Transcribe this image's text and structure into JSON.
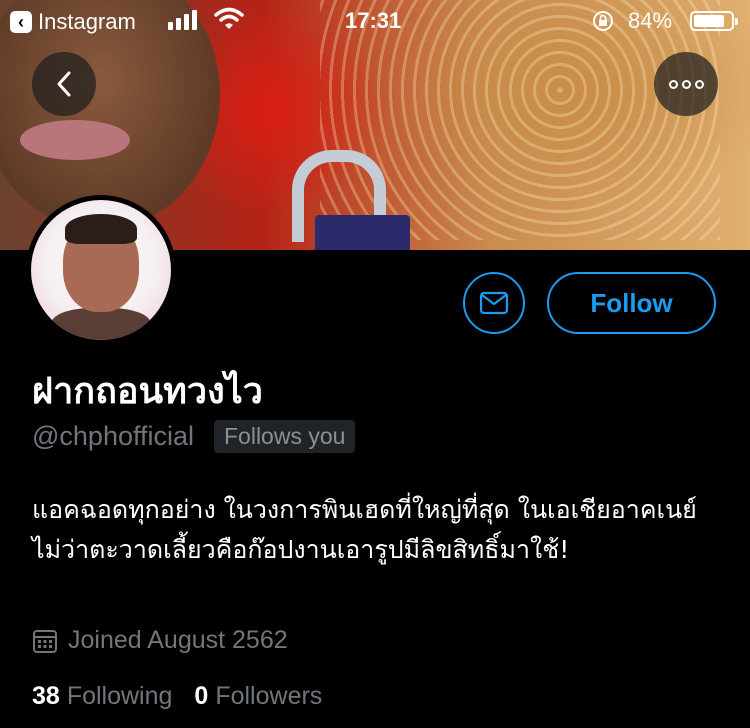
{
  "status_bar": {
    "back_app": "Instagram",
    "time": "17:31",
    "battery_percent": "84%",
    "battery_level": 0.84,
    "signal_bars": 4
  },
  "profile": {
    "display_name": "ฝากถอนทวงไว",
    "handle": "@chphofficial",
    "follows_you": "Follows you",
    "bio": "แอคฉอดทุกอย่าง ในวงการพินเฮดที่ใหญ่ที่สุด ในเอเชียอาคเนย์ ไม่ว่าตะวาดเลี้ยวคือก๊อปงานเอารูปมีลิขสิทธิ์มาใช้!",
    "joined": "Joined August 2562",
    "following_count": "38",
    "following_label": "Following",
    "followers_count": "0",
    "followers_label": "Followers"
  },
  "actions": {
    "follow_label": "Follow"
  },
  "icons": {
    "back": "chevron-left-icon",
    "more": "more-horizontal-icon",
    "mail": "mail-icon",
    "calendar": "calendar-icon"
  },
  "colors": {
    "accent": "#1d9bf0",
    "background": "#000000",
    "secondary_text": "#71767b"
  }
}
